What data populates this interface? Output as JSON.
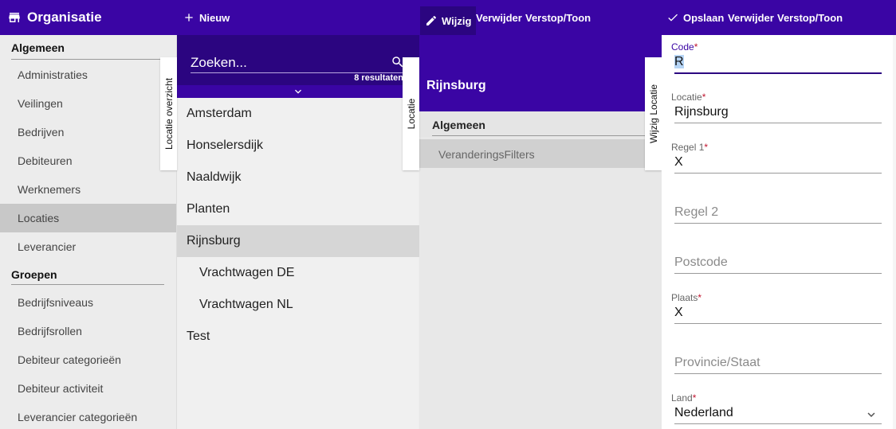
{
  "app": {
    "title": "Organisatie"
  },
  "toolbar": {
    "new_label": "Nieuw",
    "edit_label": "Wijzig",
    "delete_label": "Verwijder",
    "toggle_label": "Verstop/Toon",
    "save_label": "Opslaan",
    "delete2_label": "Verwijder",
    "toggle2_label": "Verstop/Toon"
  },
  "sidebar": {
    "section1": "Algemeen",
    "items1": [
      "Administraties",
      "Veilingen",
      "Bedrijven",
      "Debiteuren",
      "Werknemers",
      "Locaties",
      "Leverancier"
    ],
    "section2": "Groepen",
    "items2": [
      "Bedrijfsniveaus",
      "Bedrijfsrollen",
      "Debiteur categorieën",
      "Debiteur activiteit",
      "Leverancier categorieën"
    ]
  },
  "list": {
    "search_placeholder": "Zoeken...",
    "results_text": "8 resultaten",
    "items": [
      "Amsterdam",
      "Honselersdijk",
      "Naaldwijk",
      "Planten",
      "Rijnsburg",
      "Vrachtwagen DE",
      "Vrachtwagen NL",
      "Test"
    ],
    "selected": "Rijnsburg"
  },
  "tabs": {
    "list_tab": "Locatie overzicht",
    "detail_tab": "Locatie",
    "form_tab": "Wijzig Locatie"
  },
  "detail": {
    "title": "Rijnsburg",
    "section": "Algemeen",
    "item": "VeranderingsFilters"
  },
  "form": {
    "code": {
      "label": "Code",
      "value": "R"
    },
    "locatie": {
      "label": "Locatie",
      "value": "Rijnsburg"
    },
    "regel1": {
      "label": "Regel 1",
      "value": "X"
    },
    "regel2": {
      "placeholder": "Regel 2"
    },
    "postcode": {
      "placeholder": "Postcode"
    },
    "plaats": {
      "label": "Plaats",
      "value": "X"
    },
    "provincie": {
      "placeholder": "Provincie/Staat"
    },
    "land": {
      "label": "Land",
      "value": "Nederland"
    },
    "required_mark": "*"
  },
  "colors": {
    "primary": "#3a05a4",
    "primary_dark": "#2b0580",
    "required": "#c0152f"
  }
}
